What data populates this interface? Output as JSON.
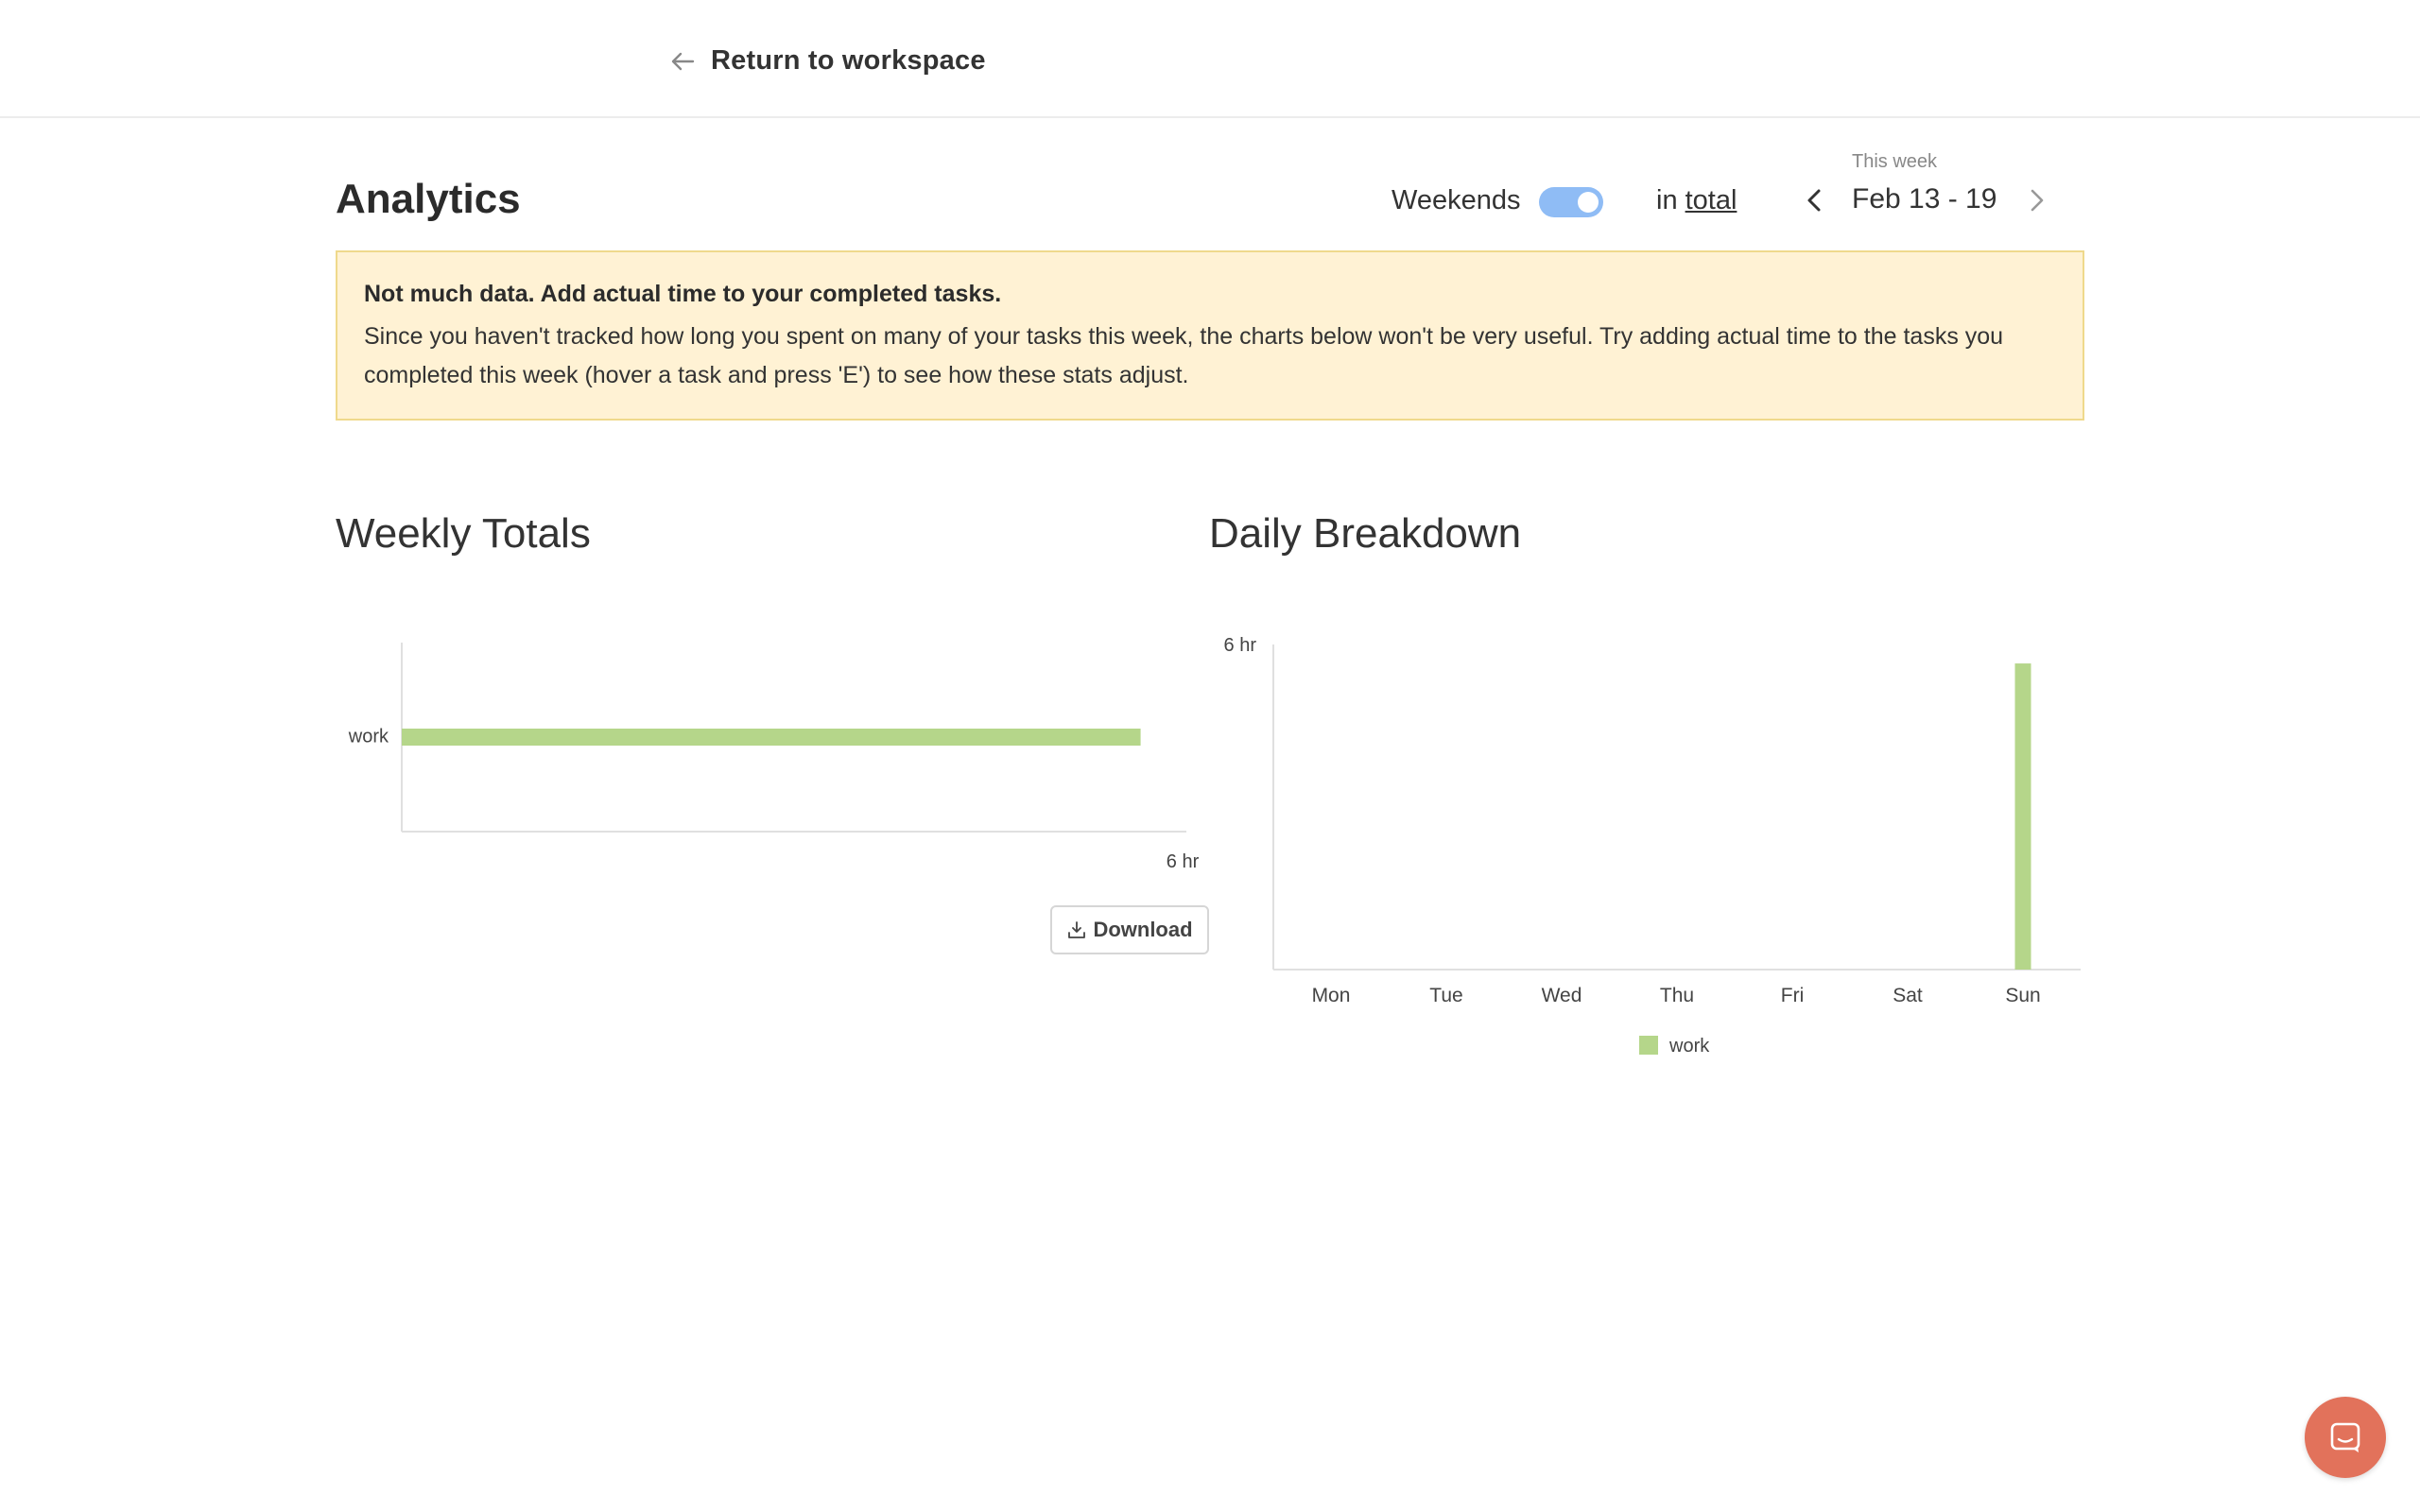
{
  "header": {
    "back_label": "Return to workspace"
  },
  "page": {
    "title": "Analytics",
    "weekends_label": "Weekends",
    "weekends_enabled": true,
    "in_label": "in",
    "total_label": "total",
    "week_caption": "This week",
    "week_range": "Feb 13 - 19"
  },
  "notice": {
    "title": "Not much data. Add actual time to your completed tasks.",
    "body": "Since you haven't tracked how long you spent on many of your tasks this week, the charts below won't be very useful. Try adding actual time to the tasks you completed this week (hover a task and press 'E') to see how these stats adjust."
  },
  "weekly": {
    "title": "Weekly Totals",
    "download_label": "Download"
  },
  "daily": {
    "title": "Daily Breakdown"
  },
  "colors": {
    "series": "#b5d68a",
    "toggle": "#8fbcf5",
    "notice_bg": "#fff2d4",
    "notice_border": "#efd98c",
    "chat": "#e2725b"
  },
  "icons": {
    "back": "arrow-left-icon",
    "prev": "chevron-left-icon",
    "next": "chevron-right-icon",
    "download": "download-icon",
    "chat": "chat-icon"
  },
  "chart_data": [
    {
      "type": "bar",
      "orientation": "horizontal",
      "title": "Weekly Totals",
      "categories": [
        "work"
      ],
      "values": [
        5.65
      ],
      "unit": "hr",
      "xlim": [
        0,
        6
      ],
      "x_tick_labels": [
        "6 hr"
      ],
      "grid": false
    },
    {
      "type": "bar",
      "title": "Daily Breakdown",
      "categories": [
        "Mon",
        "Tue",
        "Wed",
        "Thu",
        "Fri",
        "Sat",
        "Sun"
      ],
      "series": [
        {
          "name": "work",
          "values": [
            0,
            0,
            0,
            0,
            0,
            0,
            5.65
          ]
        }
      ],
      "unit": "hr",
      "ylim": [
        0,
        6
      ],
      "y_tick_labels": [
        "6 hr"
      ],
      "legend": "bottom",
      "grid": false
    }
  ]
}
